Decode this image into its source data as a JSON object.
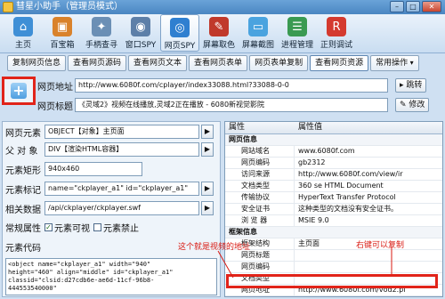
{
  "window": {
    "title": "彗星小助手（管理员模式）",
    "minimize": "–",
    "maximize": "□",
    "close": "✕"
  },
  "toolbar": [
    {
      "label": "主页",
      "icon": "home-icon",
      "glyph": "⌂",
      "color": "#3f8fd6"
    },
    {
      "label": "百宝箱",
      "icon": "toolbox-icon",
      "glyph": "▣",
      "color": "#d9822b"
    },
    {
      "label": "手柄查寻",
      "icon": "handle-icon",
      "glyph": "✦",
      "color": "#6b8fb5"
    },
    {
      "label": "窗口SPY",
      "icon": "window-spy-icon",
      "glyph": "◉",
      "color": "#5d7fa8"
    },
    {
      "label": "网页SPY",
      "icon": "web-spy-icon",
      "glyph": "◎",
      "color": "#2f7fd0"
    },
    {
      "label": "屏幕取色",
      "icon": "color-picker-icon",
      "glyph": "✎",
      "color": "#c0392b"
    },
    {
      "label": "屏幕截图",
      "icon": "screenshot-icon",
      "glyph": "▭",
      "color": "#4aa3df"
    },
    {
      "label": "进程管理",
      "icon": "process-icon",
      "glyph": "☰",
      "color": "#3a9a52"
    },
    {
      "label": "正则调试",
      "icon": "regex-icon",
      "glyph": "R",
      "color": "#d43a2f"
    }
  ],
  "tabs": [
    "复制网页信息",
    "查看网页源码",
    "查看网页文本",
    "查看网页表单",
    "网页表单复制",
    "查看网页资源",
    "常用操作"
  ],
  "address": {
    "label": "网页地址",
    "value": "http://www.6080f.com/cplayer/index33088.html?33088-0-0",
    "go": "跳转"
  },
  "pagetitle": {
    "label": "网页标题",
    "value": "《灵域2》视频在线播放,灵域2正在播放 - 6080新视觉影院",
    "modify": "修改"
  },
  "element": {
    "page_element_label": "网页元素",
    "page_element_value": "OBJECT【对象】主页面",
    "parent_label": "父 对 象",
    "parent_value": "DIV【渲染HTML容器】",
    "rect_label": "元素矩形",
    "rect_value": "940x460",
    "tag_label": "元素标记",
    "tag_value": "name=\"ckplayer_a1\" id=\"ckplayer_a1\"",
    "link_label": "相关数据",
    "link_value": "/api/ckplayer/ckplayer.swf",
    "common_label": "常规属性",
    "visible_label": "元素可视",
    "disabled_label": "元素禁止",
    "code_label": "元素代码",
    "code_value": "<object name=\"ckplayer_a1\" width=\"940\"\nheight=\"460\" align=\"middle\" id=\"ckplayer_a1\"\nclassid=\"clsid:d27cdb6e-ae6d-11cf-96b8-\n444553540000\""
  },
  "props": {
    "col1": "属性",
    "col2": "属性值",
    "section1": "网页信息",
    "rows1": [
      {
        "k": "网站域名",
        "v": "www.6080f.com"
      },
      {
        "k": "网页编码",
        "v": "gb2312"
      },
      {
        "k": "访问来源",
        "v": "http://www.6080f.com/view/ir"
      },
      {
        "k": "文档类型",
        "v": "360 se HTML Document"
      },
      {
        "k": "传输协议",
        "v": "HyperText Transfer Protocol"
      },
      {
        "k": "安全证书",
        "v": "这种类型的文档没有安全证书。"
      },
      {
        "k": "浏 览 器",
        "v": "MSIE 9.0"
      }
    ],
    "section2": "框架信息",
    "rows2": [
      {
        "k": "框架结构",
        "v": "主页面"
      },
      {
        "k": "网页标题",
        "v": ""
      },
      {
        "k": "网页编码",
        "v": ""
      },
      {
        "k": "文档类型",
        "v": ""
      },
      {
        "k": "网页地址",
        "v": "http://www.6080f.com/vod2.pl"
      }
    ]
  },
  "annotations": {
    "left": "这个就是视频的地址",
    "right": "右键可以复制"
  },
  "colors": {
    "highlight": "#e1241a",
    "annotation": "#d91a12"
  }
}
